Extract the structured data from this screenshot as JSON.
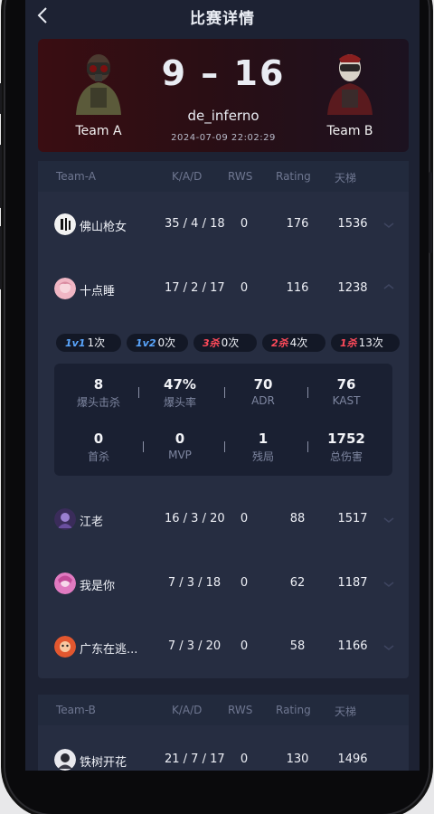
{
  "header": {
    "title": "比赛详情"
  },
  "match": {
    "score": "9 – 16",
    "map": "de_inferno",
    "time": "2024-07-09 22:02:29",
    "team_a": "Team A",
    "team_b": "Team B"
  },
  "columns": {
    "name_a": "Team-A",
    "name_b": "Team-B",
    "kda": "K/A/D",
    "rws": "RWS",
    "rating": "Rating",
    "ladder": "天梯"
  },
  "team_a_players": [
    {
      "name": "佛山枪女",
      "kda": "35 / 4 / 18",
      "rws": "0",
      "rating": "176",
      "ladder": "1536"
    },
    {
      "name": "十点睡",
      "kda": "17 / 2 / 17",
      "rws": "0",
      "rating": "116",
      "ladder": "1238"
    },
    {
      "name": "江老",
      "kda": "16 / 3 / 20",
      "rws": "0",
      "rating": "88",
      "ladder": "1517"
    },
    {
      "name": "我是你",
      "kda": "7 / 3 / 18",
      "rws": "0",
      "rating": "62",
      "ladder": "1187"
    },
    {
      "name": "广东在逃...",
      "kda": "7 / 3 / 20",
      "rws": "0",
      "rating": "58",
      "ladder": "1166"
    }
  ],
  "badges": [
    {
      "tag": "1v1",
      "value": "1次",
      "color": "#5aa7ff"
    },
    {
      "tag": "1v2",
      "value": "0次",
      "color": "#5aa7ff"
    },
    {
      "tag": "3杀",
      "value": "0次",
      "color": "#ff4a5a"
    },
    {
      "tag": "2杀",
      "value": "4次",
      "color": "#ff4a5a"
    },
    {
      "tag": "1杀",
      "value": "13次",
      "color": "#ff4a5a"
    }
  ],
  "stats": [
    {
      "value": "8",
      "label": "爆头击杀"
    },
    {
      "value": "47%",
      "label": "爆头率"
    },
    {
      "value": "70",
      "label": "ADR"
    },
    {
      "value": "76",
      "label": "KAST"
    },
    {
      "value": "0",
      "label": "首杀"
    },
    {
      "value": "0",
      "label": "MVP"
    },
    {
      "value": "1",
      "label": "残局"
    },
    {
      "value": "1752",
      "label": "总伤害"
    }
  ],
  "team_b_players": [
    {
      "name": "铁树开花",
      "kda": "21 / 7 / 17",
      "rws": "0",
      "rating": "130",
      "ladder": "1496"
    }
  ]
}
